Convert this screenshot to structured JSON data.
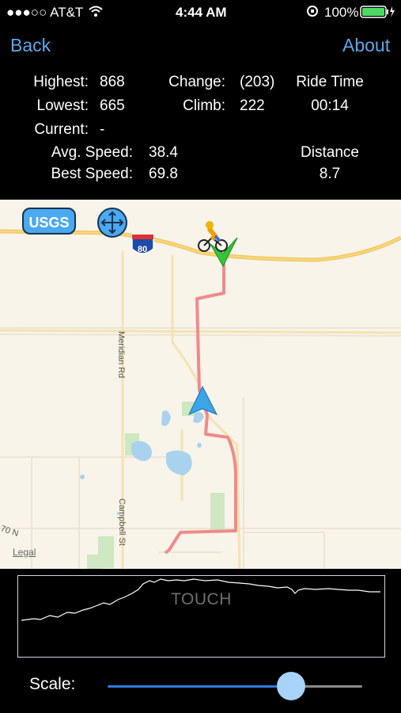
{
  "status_bar": {
    "carrier": "●●●○○ AT&T",
    "time": "4:44 AM",
    "battery": "100%"
  },
  "nav": {
    "back_label": "Back",
    "about_label": "About"
  },
  "stats": {
    "highest_label": "Highest:",
    "highest_value": "868",
    "lowest_label": "Lowest:",
    "lowest_value": "665",
    "current_label": "Current:",
    "current_value": "-",
    "change_label": "Change:",
    "change_value": "(203)",
    "climb_label": "Climb:",
    "climb_value": "222",
    "ride_time_label": "Ride Time",
    "ride_time_value": "00:14",
    "avg_speed_label": "Avg. Speed:",
    "avg_speed_value": "38.4",
    "best_speed_label": "Best Speed:",
    "best_speed_value": "69.8",
    "distance_label": "Distance",
    "distance_value": "8.7"
  },
  "map": {
    "usgs_label": "USGS",
    "interstate_number": "80",
    "road_labels": [
      "Meridian Rd",
      "Campbell St",
      "70 N"
    ],
    "legal_label": "Legal",
    "route_color": "#f08a8a",
    "marker_color": "#3aa6e8",
    "start_icon": "green-check-icon",
    "rider_icon": "bicycle-rider-icon",
    "move_icon": "crosshair-arrows-icon"
  },
  "profile": {
    "overlay_label": "TOUCH"
  },
  "scale": {
    "label": "Scale:",
    "value": 0.72
  }
}
